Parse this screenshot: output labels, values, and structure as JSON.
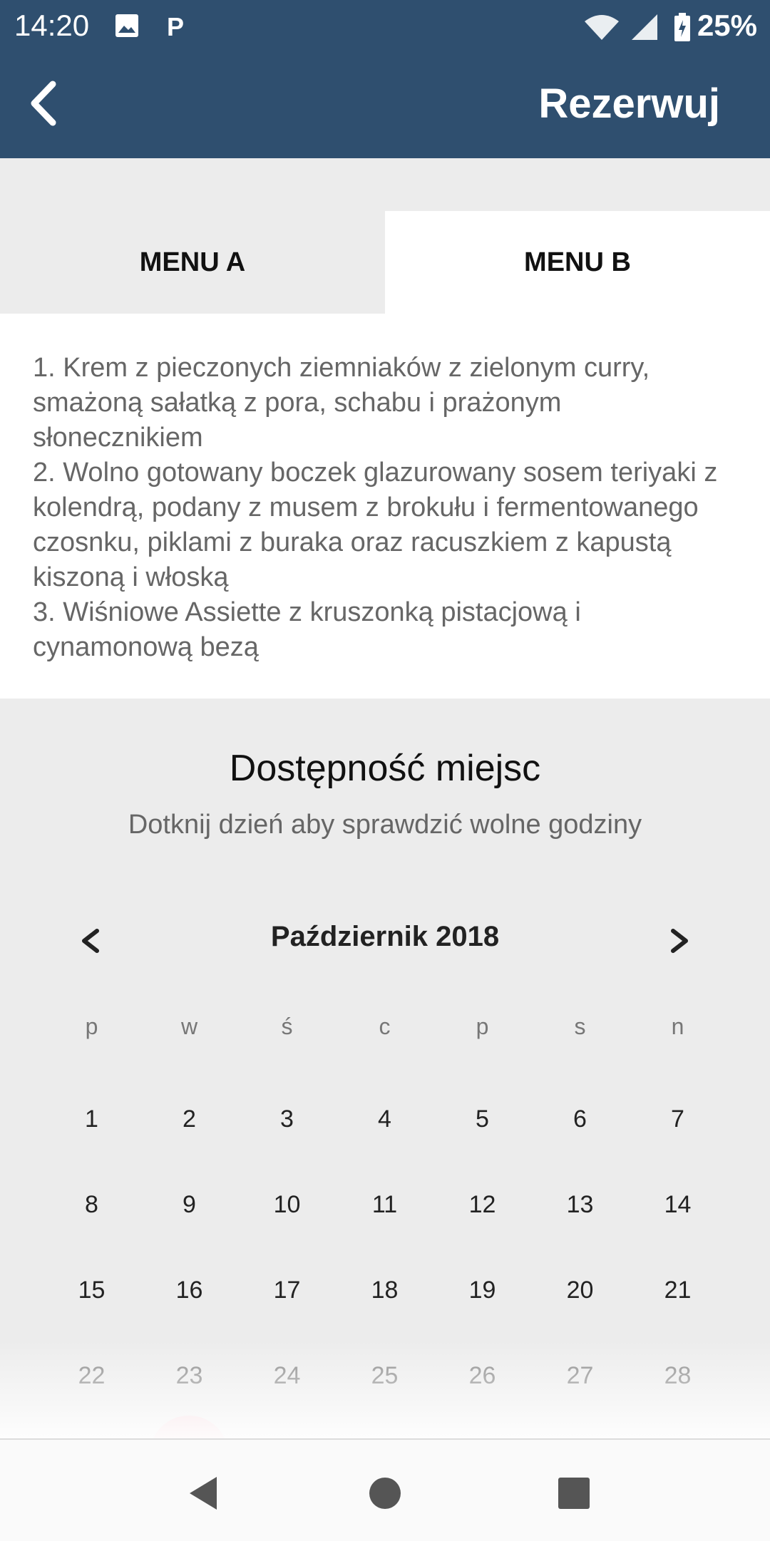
{
  "status_bar": {
    "time": "14:20",
    "battery": "25%",
    "icons": [
      "image-icon",
      "parking-p-icon",
      "wifi-icon",
      "signal-icon",
      "battery-charging-icon"
    ]
  },
  "app_bar": {
    "title": "Rezerwuj",
    "back_icon": "chevron-left-icon",
    "color": "#2f4f6f"
  },
  "tabs": [
    {
      "label": "MENU A",
      "selected": false
    },
    {
      "label": "MENU B",
      "selected": true
    }
  ],
  "menu_text": "1. Krem z pieczonych ziemniaków z zielonym curry, smażoną sałatką z pora, schabu i prażonym słonecznikiem\n2. Wolno gotowany boczek glazurowany sosem teriyaki z kolendrą, podany z musem z brokułu i fermentowanego czosnku, piklami z buraka oraz racuszkiem z kapustą kiszoną i włoską\n3. Wiśniowe Assiette z kruszonką pistacjową i cynamonową bezą",
  "availability": {
    "title": "Dostępność miejsc",
    "subtitle": "Dotknij dzień aby sprawdzić wolne godziny"
  },
  "calendar": {
    "month": "Październik 2018",
    "weekdays": [
      "p",
      "w",
      "ś",
      "c",
      "p",
      "s",
      "n"
    ],
    "weeks": [
      [
        "1",
        "2",
        "3",
        "4",
        "5",
        "6",
        "7"
      ],
      [
        "8",
        "9",
        "10",
        "11",
        "12",
        "13",
        "14"
      ],
      [
        "15",
        "16",
        "17",
        "18",
        "19",
        "20",
        "21"
      ],
      [
        "22",
        "23",
        "24",
        "25",
        "26",
        "27",
        "28"
      ]
    ]
  },
  "nav_bar": {
    "icons": [
      "back-triangle-icon",
      "home-circle-icon",
      "recents-square-icon"
    ]
  }
}
